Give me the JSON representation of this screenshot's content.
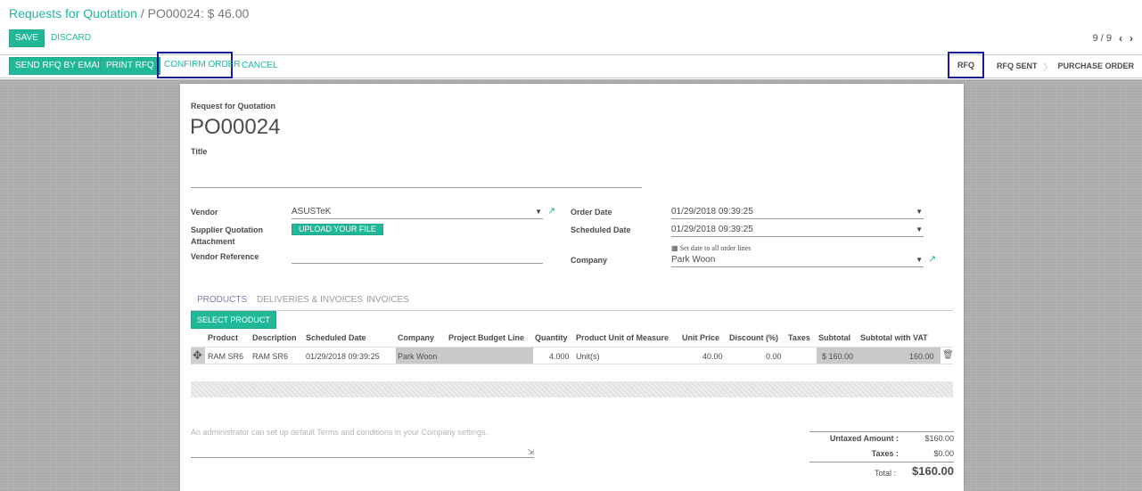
{
  "breadcrumb": {
    "parent": "Requests for Quotation",
    "separator": "/",
    "current": "PO00024: $ 46.00"
  },
  "toolbar": {
    "save_label": "SAVE",
    "discard_label": "DISCARD"
  },
  "pager": {
    "text": "9 / 9",
    "prev_icon": "chevron-left-icon",
    "next_icon": "chevron-right-icon"
  },
  "actions": {
    "send_rfq": "SEND RFQ BY EMAIL",
    "print_rfq": "PRINT RFQ",
    "confirm": "CONFIRM ORDER",
    "cancel": "CANCEL"
  },
  "stages": [
    {
      "label": "RFQ",
      "active": true
    },
    {
      "label": "RFQ SENT",
      "active": false
    },
    {
      "label": "PURCHASE ORDER",
      "active": false
    }
  ],
  "form": {
    "doc_type": "Request for Quotation",
    "name": "PO00024",
    "title_label": "Title",
    "title_value": "",
    "vendor_label": "Vendor",
    "vendor_value": "ASUSTeK",
    "attachment_label_1": "Supplier Quotation",
    "attachment_label_2": "Attachment",
    "upload_label": "UPLOAD YOUR FILE",
    "vendor_ref_label": "Vendor Reference",
    "vendor_ref_value": "",
    "order_date_label": "Order Date",
    "order_date_value": "01/29/2018 09:39:25",
    "scheduled_date_label": "Scheduled Date",
    "scheduled_date_value": "01/29/2018 09:39:25",
    "set_date_link": "Set date to all order lines",
    "company_label": "Company",
    "company_value": "Park Woon"
  },
  "tabs": [
    {
      "label": "PRODUCTS",
      "active": true
    },
    {
      "label": "DELIVERIES & INVOICES",
      "active": false
    },
    {
      "label": "INVOICES",
      "active": false
    }
  ],
  "select_product_label": "SELECT PRODUCT",
  "table": {
    "headers": [
      "Product",
      "Description",
      "Scheduled Date",
      "Company",
      "Project Budget Line",
      "Quantity",
      "Product Unit of Measure",
      "Unit Price",
      "Discount (%)",
      "Taxes",
      "Subtotal",
      "Subtotal with VAT"
    ],
    "rows": [
      {
        "product": "RAM SR6",
        "description": "RAM SR6",
        "scheduled_date": "01/29/2018 09:39:25",
        "company": "Park Woon",
        "budget_line": "",
        "quantity": "4.000",
        "uom": "Unit(s)",
        "unit_price": "40.00",
        "discount": "0.00",
        "taxes": "",
        "subtotal": "$ 160.00",
        "subtotal_vat": "160.00"
      }
    ]
  },
  "terms_placeholder": "An administrator can set up default Terms and conditions in your Company settings.",
  "totals": {
    "untaxed_label": "Untaxed Amount :",
    "untaxed_value": "$160.00",
    "taxes_label": "Taxes :",
    "taxes_value": "$0.00",
    "total_label": "Total :",
    "total_value": "$160.00"
  },
  "colors": {
    "primary": "#21b799",
    "highlight": "#1b1b9a",
    "tab_active": "#7c7bad"
  }
}
